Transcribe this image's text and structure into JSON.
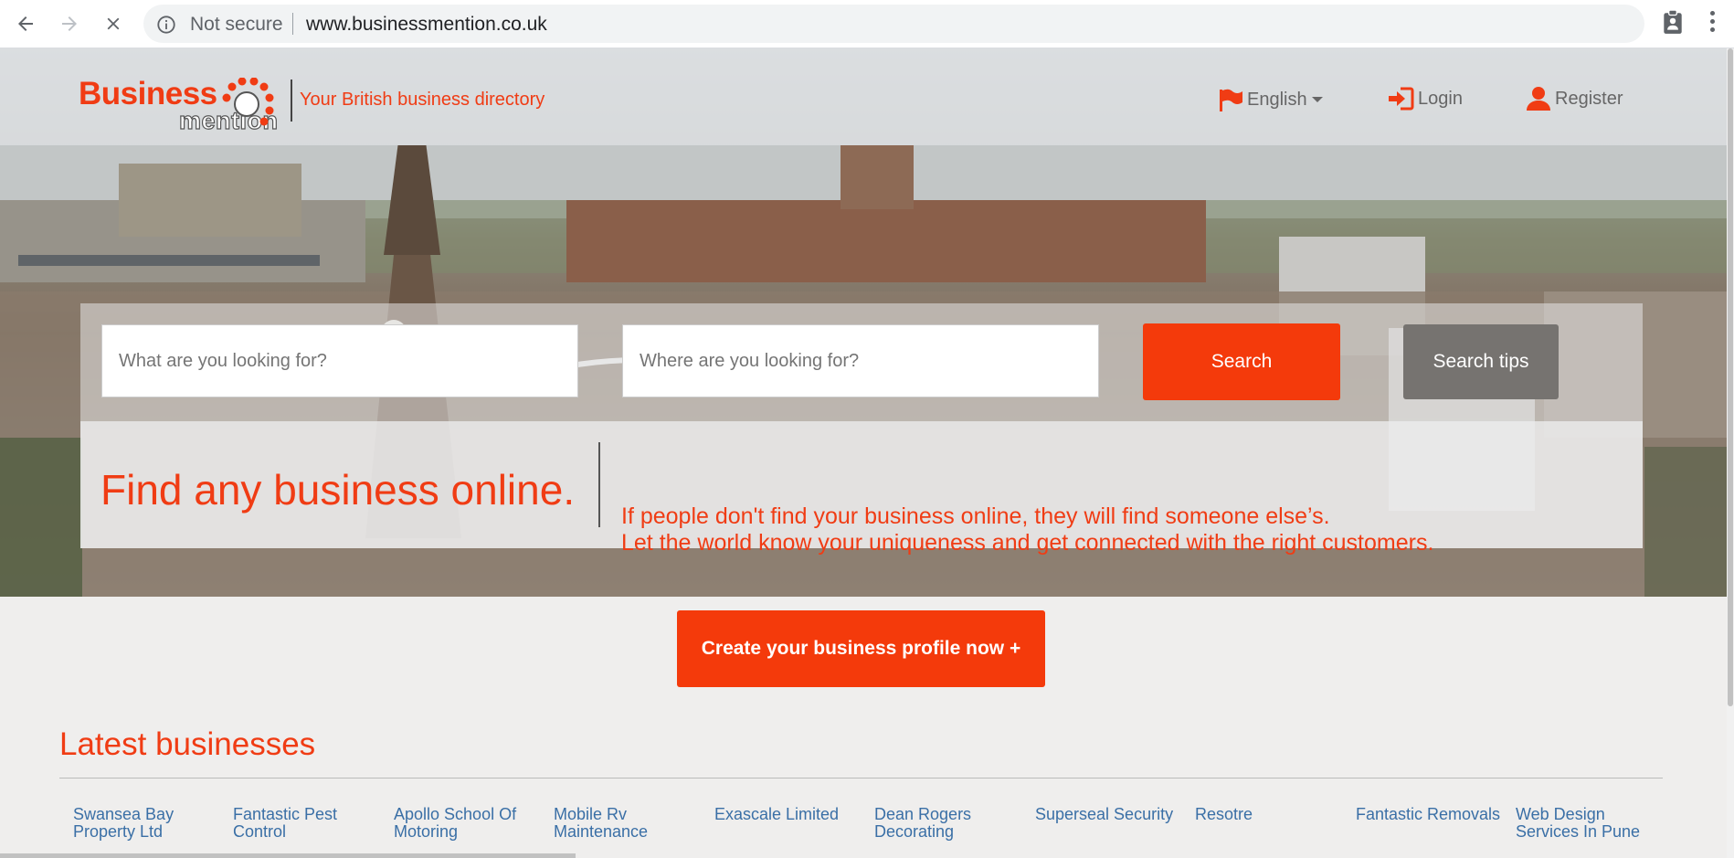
{
  "browser": {
    "security_status": "Not secure",
    "url": "www.businessmention.co.uk"
  },
  "header": {
    "logo_word1": "Business",
    "logo_word2": "mention",
    "tagline": "Your British business directory",
    "language": "English",
    "login": "Login",
    "register": "Register"
  },
  "search": {
    "what_placeholder": "What are you looking for?",
    "where_placeholder": "Where are you looking for?",
    "search_label": "Search",
    "tips_label": "Search tips"
  },
  "promo": {
    "title": "Find any business online.",
    "line1": "If people don't find your business online, they will find someone else’s.",
    "line2": "Let the world know your uniqueness and get connected with the right customers."
  },
  "cta": "Create your business profile now +",
  "latest": {
    "title": "Latest businesses",
    "items": [
      "Swansea Bay Property Ltd",
      "Fantastic Pest Control",
      "Apollo School Of Motoring",
      "Mobile Rv Maintenance",
      "Exascale Limited",
      "Dean Rogers Decorating",
      "Superseal Security",
      "Resotre",
      "Fantastic Removals",
      "Web Design Services In Pune"
    ]
  },
  "colors": {
    "brand": "#f03c14",
    "button": "#f43a0b",
    "tips_button": "#767370",
    "link": "#3a6fa6"
  }
}
